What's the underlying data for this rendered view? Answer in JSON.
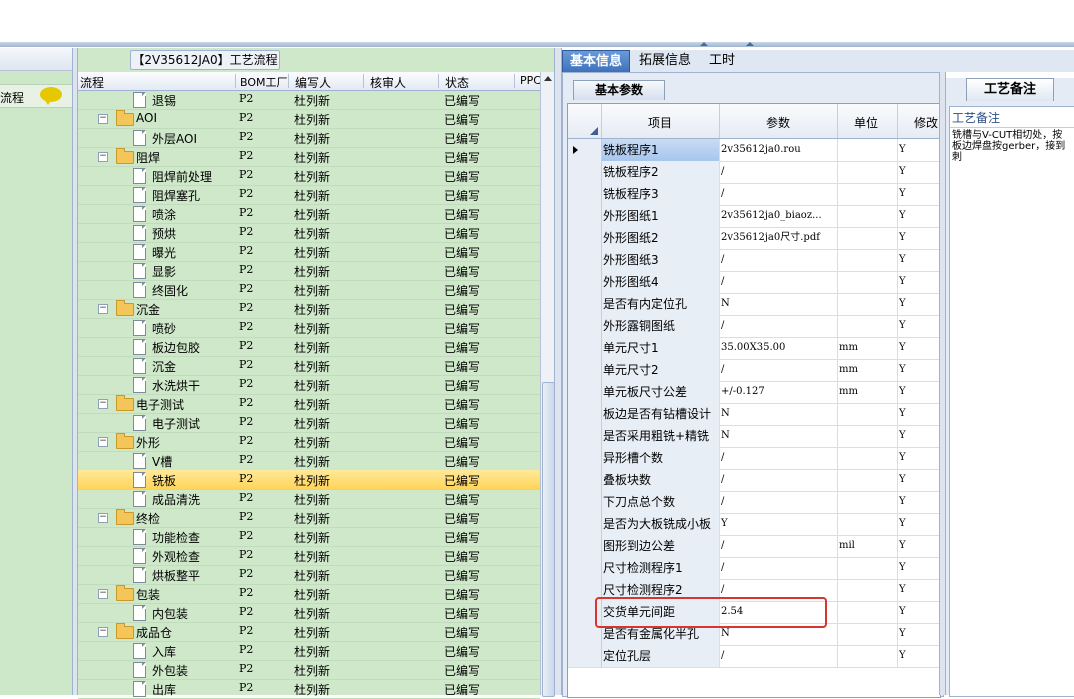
{
  "left_panel": {
    "label": "流程"
  },
  "tree": {
    "title": "【2V35612JA0】工艺流程",
    "columns": [
      "流程",
      "BOM工厂",
      "编写人",
      "核审人",
      "状态",
      "PPC"
    ],
    "rows": [
      {
        "level": 2,
        "type": "doc",
        "name": "退锡",
        "factory": "P2",
        "writer": "杜列新",
        "status": "已编写"
      },
      {
        "level": 1,
        "type": "folder",
        "name": "AOI",
        "factory": "P2",
        "writer": "杜列新",
        "status": "已编写"
      },
      {
        "level": 2,
        "type": "doc",
        "name": "外层AOI",
        "factory": "P2",
        "writer": "杜列新",
        "status": "已编写"
      },
      {
        "level": 1,
        "type": "folder",
        "name": "阻焊",
        "factory": "P2",
        "writer": "杜列新",
        "status": "已编写"
      },
      {
        "level": 2,
        "type": "doc",
        "name": "阻焊前处理",
        "factory": "P2",
        "writer": "杜列新",
        "status": "已编写"
      },
      {
        "level": 2,
        "type": "doc",
        "name": "阻焊塞孔",
        "factory": "P2",
        "writer": "杜列新",
        "status": "已编写"
      },
      {
        "level": 2,
        "type": "doc",
        "name": "喷涂",
        "factory": "P2",
        "writer": "杜列新",
        "status": "已编写"
      },
      {
        "level": 2,
        "type": "doc",
        "name": "预烘",
        "factory": "P2",
        "writer": "杜列新",
        "status": "已编写"
      },
      {
        "level": 2,
        "type": "doc",
        "name": "曝光",
        "factory": "P2",
        "writer": "杜列新",
        "status": "已编写"
      },
      {
        "level": 2,
        "type": "doc",
        "name": "显影",
        "factory": "P2",
        "writer": "杜列新",
        "status": "已编写"
      },
      {
        "level": 2,
        "type": "doc",
        "name": "终固化",
        "factory": "P2",
        "writer": "杜列新",
        "status": "已编写"
      },
      {
        "level": 1,
        "type": "folder",
        "name": "沉金",
        "factory": "P2",
        "writer": "杜列新",
        "status": "已编写"
      },
      {
        "level": 2,
        "type": "doc",
        "name": "喷砂",
        "factory": "P2",
        "writer": "杜列新",
        "status": "已编写"
      },
      {
        "level": 2,
        "type": "doc",
        "name": "板边包胶",
        "factory": "P2",
        "writer": "杜列新",
        "status": "已编写"
      },
      {
        "level": 2,
        "type": "doc",
        "name": "沉金",
        "factory": "P2",
        "writer": "杜列新",
        "status": "已编写"
      },
      {
        "level": 2,
        "type": "doc",
        "name": "水洗烘干",
        "factory": "P2",
        "writer": "杜列新",
        "status": "已编写"
      },
      {
        "level": 1,
        "type": "folder",
        "name": "电子测试",
        "factory": "P2",
        "writer": "杜列新",
        "status": "已编写"
      },
      {
        "level": 2,
        "type": "doc",
        "name": "电子测试",
        "factory": "P2",
        "writer": "杜列新",
        "status": "已编写"
      },
      {
        "level": 1,
        "type": "folder",
        "name": "外形",
        "factory": "P2",
        "writer": "杜列新",
        "status": "已编写"
      },
      {
        "level": 2,
        "type": "doc",
        "name": "V槽",
        "factory": "P2",
        "writer": "杜列新",
        "status": "已编写"
      },
      {
        "level": 2,
        "type": "doc",
        "name": "铣板",
        "factory": "P2",
        "writer": "杜列新",
        "status": "已编写",
        "selected": true
      },
      {
        "level": 2,
        "type": "doc",
        "name": "成品清洗",
        "factory": "P2",
        "writer": "杜列新",
        "status": "已编写"
      },
      {
        "level": 1,
        "type": "folder",
        "name": "终检",
        "factory": "P2",
        "writer": "杜列新",
        "status": "已编写"
      },
      {
        "level": 2,
        "type": "doc",
        "name": "功能检查",
        "factory": "P2",
        "writer": "杜列新",
        "status": "已编写"
      },
      {
        "level": 2,
        "type": "doc",
        "name": "外观检查",
        "factory": "P2",
        "writer": "杜列新",
        "status": "已编写"
      },
      {
        "level": 2,
        "type": "doc",
        "name": "烘板整平",
        "factory": "P2",
        "writer": "杜列新",
        "status": "已编写"
      },
      {
        "level": 1,
        "type": "folder",
        "name": "包装",
        "factory": "P2",
        "writer": "杜列新",
        "status": "已编写"
      },
      {
        "level": 2,
        "type": "doc",
        "name": "内包装",
        "factory": "P2",
        "writer": "杜列新",
        "status": "已编写"
      },
      {
        "level": 1,
        "type": "folder",
        "name": "成品仓",
        "factory": "P2",
        "writer": "杜列新",
        "status": "已编写"
      },
      {
        "level": 2,
        "type": "doc",
        "name": "入库",
        "factory": "P2",
        "writer": "杜列新",
        "status": "已编写"
      },
      {
        "level": 2,
        "type": "doc",
        "name": "外包装",
        "factory": "P2",
        "writer": "杜列新",
        "status": "已编写"
      },
      {
        "level": 2,
        "type": "doc",
        "name": "出库",
        "factory": "P2",
        "writer": "杜列新",
        "status": "已编写"
      }
    ]
  },
  "tabs": [
    "基本信息",
    "拓展信息",
    "工时"
  ],
  "params": {
    "subtab": "基本参数",
    "columns": [
      "项目",
      "参数",
      "单位",
      "修改"
    ],
    "rows": [
      {
        "item": "铣板程序1",
        "value": "2v35612ja0.rou",
        "unit": "",
        "mod": "Y",
        "current": true
      },
      {
        "item": "铣板程序2",
        "value": "/",
        "unit": "",
        "mod": "Y"
      },
      {
        "item": "铣板程序3",
        "value": "/",
        "unit": "",
        "mod": "Y"
      },
      {
        "item": "外形图纸1",
        "value": "2v35612ja0_biaoz...",
        "unit": "",
        "mod": "Y"
      },
      {
        "item": "外形图纸2",
        "value": "2v35612ja0尺寸.pdf",
        "unit": "",
        "mod": "Y"
      },
      {
        "item": "外形图纸3",
        "value": "/",
        "unit": "",
        "mod": "Y"
      },
      {
        "item": "外形图纸4",
        "value": "/",
        "unit": "",
        "mod": "Y"
      },
      {
        "item": "是否有内定位孔",
        "value": "N",
        "unit": "",
        "mod": "Y"
      },
      {
        "item": "外形露铜图纸",
        "value": "/",
        "unit": "",
        "mod": "Y"
      },
      {
        "item": "单元尺寸1",
        "value": "35.00X35.00",
        "unit": "mm",
        "mod": "Y"
      },
      {
        "item": "单元尺寸2",
        "value": "/",
        "unit": "mm",
        "mod": "Y"
      },
      {
        "item": "单元板尺寸公差",
        "value": "+/-0.127",
        "unit": "mm",
        "mod": "Y"
      },
      {
        "item": "板边是否有钻槽设计",
        "value": "N",
        "unit": "",
        "mod": "Y"
      },
      {
        "item": "是否采用粗铣+精铣",
        "value": "N",
        "unit": "",
        "mod": "Y"
      },
      {
        "item": "异形槽个数",
        "value": "/",
        "unit": "",
        "mod": "Y"
      },
      {
        "item": "叠板块数",
        "value": "/",
        "unit": "",
        "mod": "Y"
      },
      {
        "item": "下刀点总个数",
        "value": "/",
        "unit": "",
        "mod": "Y"
      },
      {
        "item": "是否为大板铣成小板",
        "value": "Y",
        "unit": "",
        "mod": "Y"
      },
      {
        "item": "图形到边公差",
        "value": "/",
        "unit": "mil",
        "mod": "Y"
      },
      {
        "item": "尺寸检测程序1",
        "value": "/",
        "unit": "",
        "mod": "Y"
      },
      {
        "item": "尺寸检测程序2",
        "value": "/",
        "unit": "",
        "mod": "Y"
      },
      {
        "item": "交货单元间距",
        "value": "2.54",
        "unit": "",
        "mod": "Y"
      },
      {
        "item": "是否有金属化半孔",
        "value": "N",
        "unit": "",
        "mod": "Y"
      },
      {
        "item": "定位孔层",
        "value": "/",
        "unit": "",
        "mod": "Y"
      }
    ]
  },
  "notes": {
    "tab": "工艺备注",
    "label": "工艺备注",
    "text": "铣槽与V-CUT相切处，按\n板边焊盘按gerber，接到\n刺"
  }
}
